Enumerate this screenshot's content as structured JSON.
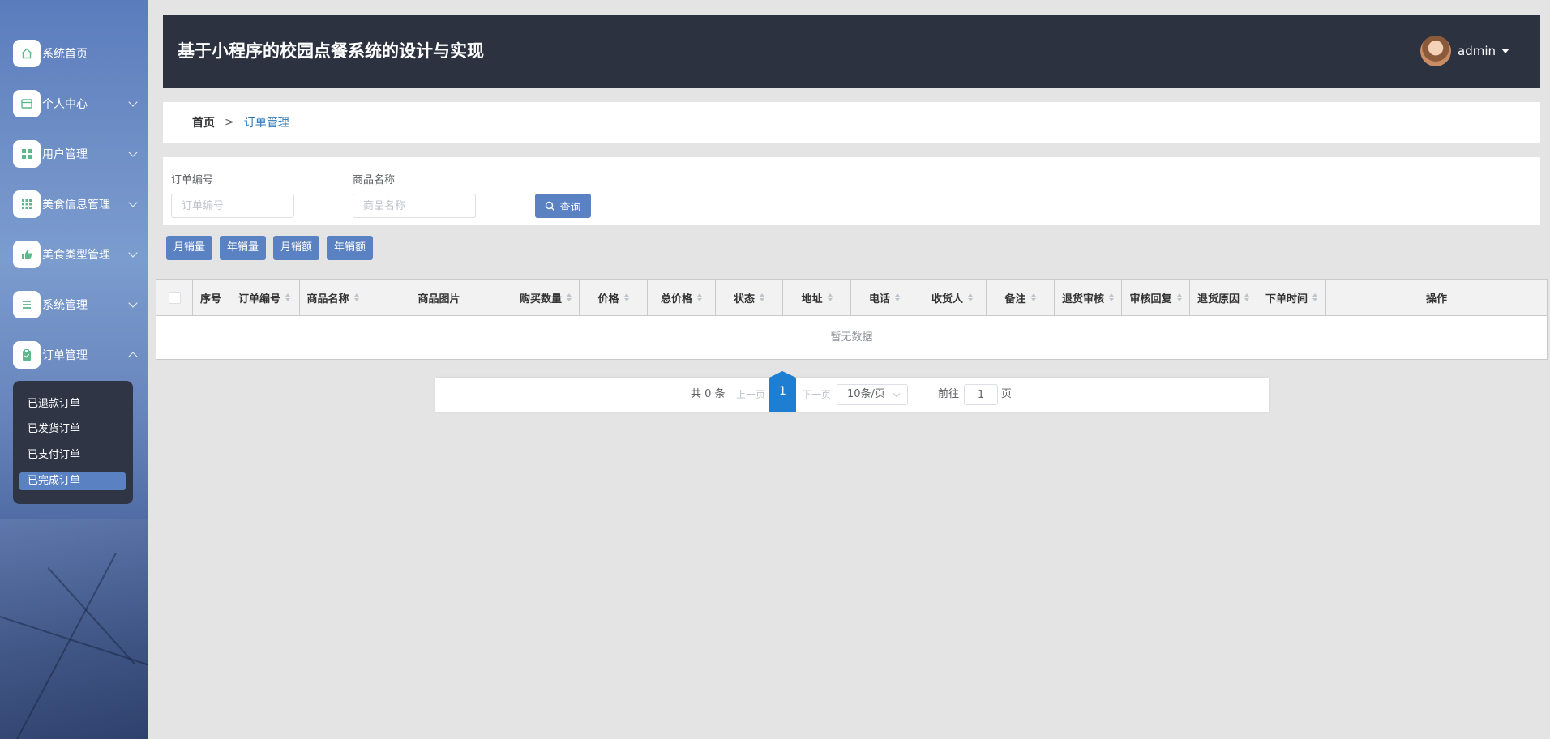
{
  "header": {
    "title": "基于小程序的校园点餐系统的设计与实现",
    "user": "admin"
  },
  "sidebar": {
    "items": [
      {
        "label": "系统首页",
        "icon": "home-icon"
      },
      {
        "label": "个人中心",
        "icon": "card-icon"
      },
      {
        "label": "用户管理",
        "icon": "grid-icon"
      },
      {
        "label": "美食信息管理",
        "icon": "apps-icon"
      },
      {
        "label": "美食类型管理",
        "icon": "thumb-icon"
      },
      {
        "label": "系统管理",
        "icon": "list-icon"
      },
      {
        "label": "订单管理",
        "icon": "clipboard-icon"
      }
    ],
    "submenu": [
      "已退款订单",
      "已发货订单",
      "已支付订单",
      "已完成订单"
    ],
    "submenu_active": "已完成订单"
  },
  "breadcrumb": {
    "home": "首页",
    "separator": ">",
    "current": "订单管理"
  },
  "search": {
    "order_label": "订单编号",
    "order_placeholder": "订单编号",
    "product_label": "商品名称",
    "product_placeholder": "商品名称",
    "button": "查询"
  },
  "stats": [
    "月销量",
    "年销量",
    "月销额",
    "年销额"
  ],
  "table": {
    "columns": [
      "序号",
      "订单编号",
      "商品名称",
      "商品图片",
      "购买数量",
      "价格",
      "总价格",
      "状态",
      "地址",
      "电话",
      "收货人",
      "备注",
      "退货审核",
      "审核回复",
      "退货原因",
      "下单时间",
      "操作"
    ],
    "empty": "暂无数据"
  },
  "pagination": {
    "total": "共 0 条",
    "prev": "上一页",
    "page": "1",
    "next": "下一页",
    "page_size": "10条/页",
    "goto": "前往",
    "goto_value": "1",
    "page_unit": "页"
  },
  "colors": {
    "header_bg": "#2d3241",
    "accent": "#5a82c2",
    "page_active": "#1e7ed1",
    "link": "#2a7ab9"
  }
}
